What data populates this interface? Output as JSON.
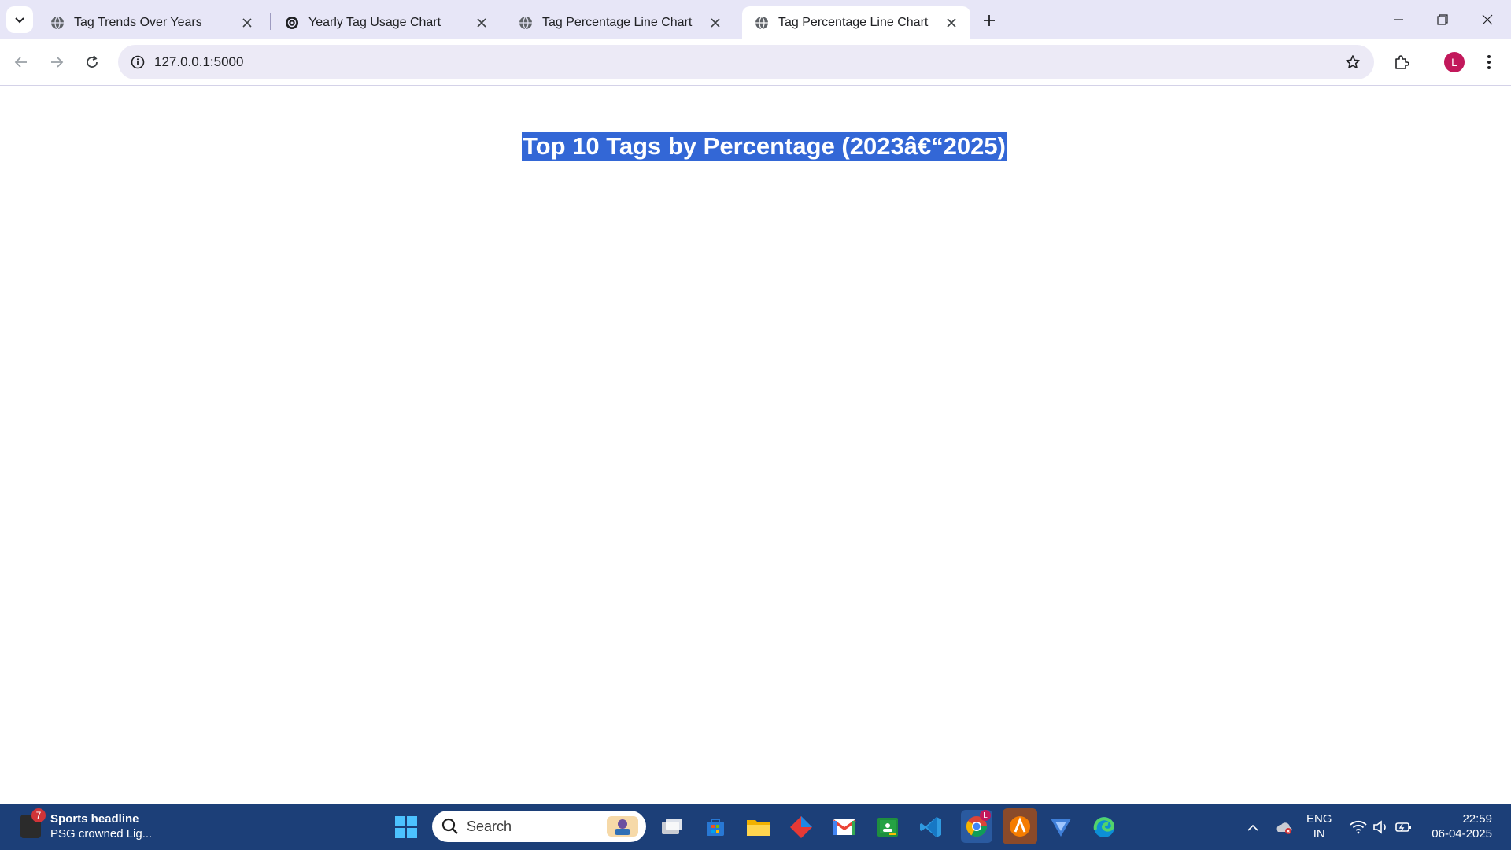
{
  "browser": {
    "tabs": [
      {
        "title": "Tag Trends Over Years",
        "favicon": "globe-icon",
        "active": false
      },
      {
        "title": "Yearly Tag Usage Chart",
        "favicon": "openai-icon",
        "active": false
      },
      {
        "title": "Tag Percentage Line Chart",
        "favicon": "globe-icon",
        "active": false
      },
      {
        "title": "Tag Percentage Line Chart",
        "favicon": "globe-icon",
        "active": true
      }
    ],
    "url": "127.0.0.1:5000",
    "profile_initial": "L"
  },
  "page": {
    "heading": "Top 10 Tags by Percentage (2023â€“2025)"
  },
  "taskbar": {
    "news_headline": "Sports headline",
    "news_sub": "PSG crowned Lig...",
    "news_badge": "7",
    "search_label": "Search",
    "lang_line1": "ENG",
    "lang_line2": "IN",
    "time": "22:59",
    "date": "06-04-2025",
    "chrome_badge": "L"
  },
  "colors": {
    "tabstrip": "#e7e6f7",
    "selection": "#3367d6",
    "taskbar": "#1c3f78",
    "avatar": "#c2185b"
  }
}
